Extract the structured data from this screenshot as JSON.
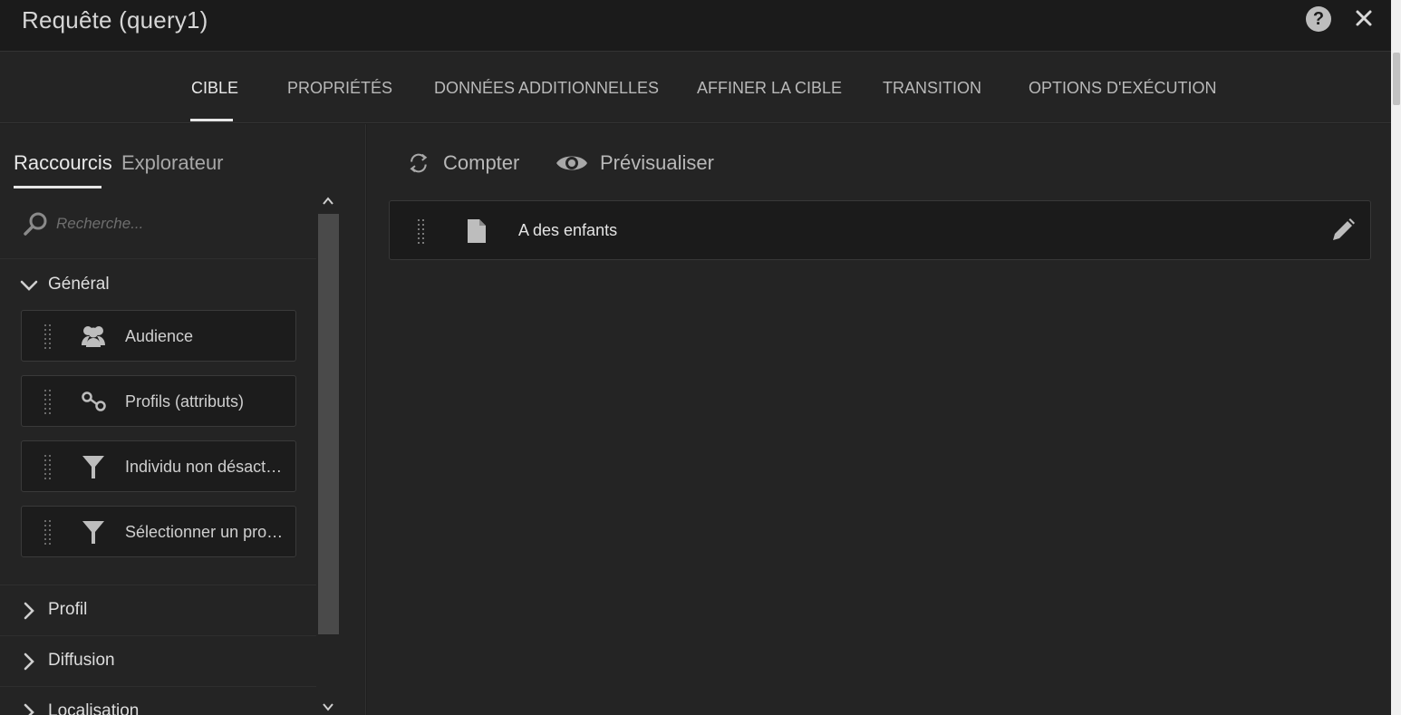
{
  "window": {
    "title": "Requête (query1)",
    "help_icon": "help-icon",
    "close_icon": "close-icon",
    "help_symbol": "?"
  },
  "tabs": [
    {
      "label": "CIBLE",
      "active": true
    },
    {
      "label": "PROPRIÉTÉS",
      "active": false
    },
    {
      "label": "DONNÉES ADDITIONNELLES",
      "active": false
    },
    {
      "label": "AFFINER LA CIBLE",
      "active": false
    },
    {
      "label": "TRANSITION",
      "active": false
    },
    {
      "label": "OPTIONS D'EXÉCUTION",
      "active": false
    }
  ],
  "left_panel": {
    "subtabs": [
      {
        "label": "Raccourcis",
        "active": true
      },
      {
        "label": "Explorateur",
        "active": false
      }
    ],
    "search": {
      "placeholder": "Recherche...",
      "value": "",
      "icon": "search-icon"
    },
    "sections": [
      {
        "label": "Général",
        "expanded": true,
        "items": [
          {
            "label": "Audience",
            "icon": "audience-icon"
          },
          {
            "label": "Profils (attributs)",
            "icon": "link-icon"
          },
          {
            "label": "Individu non désacti…",
            "icon": "filter-icon"
          },
          {
            "label": "Sélectionner un prof…",
            "icon": "filter-icon"
          }
        ]
      },
      {
        "label": "Profil",
        "expanded": false
      },
      {
        "label": "Diffusion",
        "expanded": false
      },
      {
        "label": "Localisation",
        "expanded": false
      }
    ]
  },
  "main": {
    "actions": [
      {
        "label": "Compter",
        "icon": "refresh-icon"
      },
      {
        "label": "Prévisualiser",
        "icon": "eye-icon"
      }
    ],
    "conditions": [
      {
        "label": "A des enfants",
        "icon": "document-icon",
        "edit_icon": "pencil-icon"
      }
    ]
  },
  "colors": {
    "background": "#242424",
    "titlebar": "#1b1b1b",
    "active_text": "#eaeaea",
    "inactive_text": "#b9b9b9",
    "card": "#1c1c1c"
  }
}
